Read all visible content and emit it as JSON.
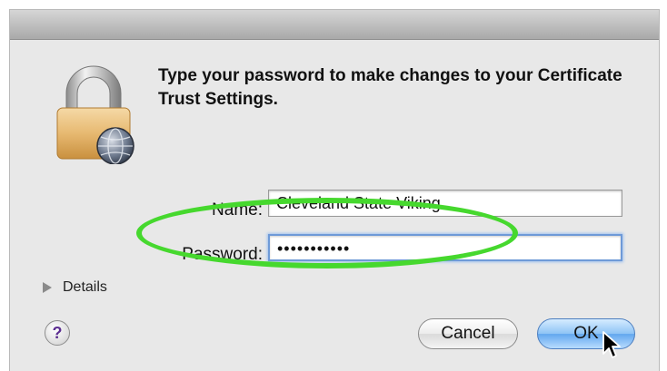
{
  "dialog": {
    "prompt": "Type your password to make changes to your Certificate Trust Settings.",
    "name_label": "Name:",
    "name_value": "Cleveland State Viking",
    "password_label": "Password:",
    "password_value": "•••••••••••",
    "details_label": "Details",
    "help_label": "?",
    "cancel_label": "Cancel",
    "ok_label": "OK"
  },
  "icons": {
    "lock": "lock-globe-icon",
    "disclosure": "disclosure-triangle-icon",
    "cursor": "mouse-pointer-icon"
  },
  "colors": {
    "highlight_ring": "#46d82e",
    "focus_ring": "#6e9ad8",
    "default_button": "#62a7ee",
    "help_mark": "#5c2e91"
  }
}
